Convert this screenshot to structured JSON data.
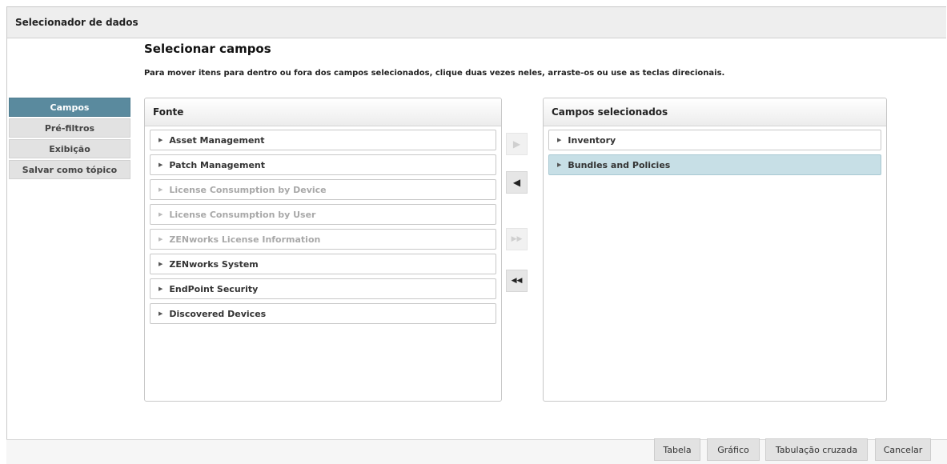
{
  "window": {
    "title": "Selecionador de dados"
  },
  "main": {
    "heading": "Selecionar campos",
    "instructions": "Para mover itens para dentro ou fora dos campos selecionados, clique duas vezes neles, arraste-os ou use as teclas direcionais."
  },
  "nav": {
    "items": [
      {
        "label": "Campos",
        "active": true
      },
      {
        "label": "Pré-filtros",
        "active": false
      },
      {
        "label": "Exibição",
        "active": false
      },
      {
        "label": "Salvar como tópico",
        "active": false
      }
    ]
  },
  "source": {
    "header": "Fonte",
    "items": [
      {
        "label": "Asset Management",
        "enabled": true
      },
      {
        "label": "Patch Management",
        "enabled": true
      },
      {
        "label": "License Consumption by Device",
        "enabled": false
      },
      {
        "label": "License Consumption by User",
        "enabled": false
      },
      {
        "label": "ZENworks License Information",
        "enabled": false
      },
      {
        "label": "ZENworks System",
        "enabled": true
      },
      {
        "label": "EndPoint Security",
        "enabled": true
      },
      {
        "label": "Discovered Devices",
        "enabled": true
      }
    ]
  },
  "selected": {
    "header": "Campos selecionados",
    "items": [
      {
        "label": "Inventory",
        "highlighted": false
      },
      {
        "label": "Bundles and Policies",
        "highlighted": true
      }
    ]
  },
  "move_buttons": {
    "add": {
      "glyph": "▶",
      "enabled": false
    },
    "remove": {
      "glyph": "◀",
      "enabled": true
    },
    "add_all": {
      "glyph": "▶▶",
      "enabled": false
    },
    "remove_all": {
      "glyph": "◀◀",
      "enabled": true
    }
  },
  "footer": {
    "table_label": "Tabela",
    "chart_label": "Gráfico",
    "crosstab_label": "Tabulação cruzada",
    "cancel_label": "Cancelar"
  },
  "colors": {
    "nav_active": "#5a8a9e",
    "selected_row": "#c7dfe6"
  }
}
